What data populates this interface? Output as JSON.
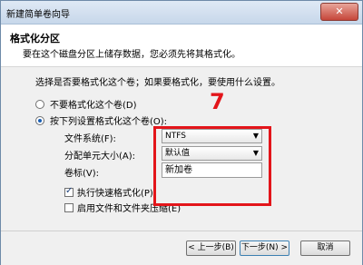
{
  "window": {
    "title": "新建简单卷向导",
    "close_label": "✕"
  },
  "header": {
    "title": "格式化分区",
    "subtitle": "要在这个磁盘分区上储存数据，您必须先将其格式化。"
  },
  "body": {
    "prompt": "选择是否要格式化这个卷；如果要格式化，要使用什么设置。",
    "option_no_format": "不要格式化这个卷(D)",
    "option_format": "按下列设置格式化这个卷(O):",
    "filesystem_label": "文件系统(F):",
    "filesystem_value": "NTFS",
    "alloc_label": "分配单元大小(A):",
    "alloc_value": "默认值",
    "volume_label_label": "卷标(V):",
    "volume_label_value": "新加卷",
    "quick_format_label": "执行快速格式化(P)",
    "compression_label": "启用文件和文件夹压缩(E)",
    "step_annotation": "7"
  },
  "footer": {
    "back": "< 上一步(B)",
    "next": "下一步(N) >",
    "cancel": "取消"
  }
}
